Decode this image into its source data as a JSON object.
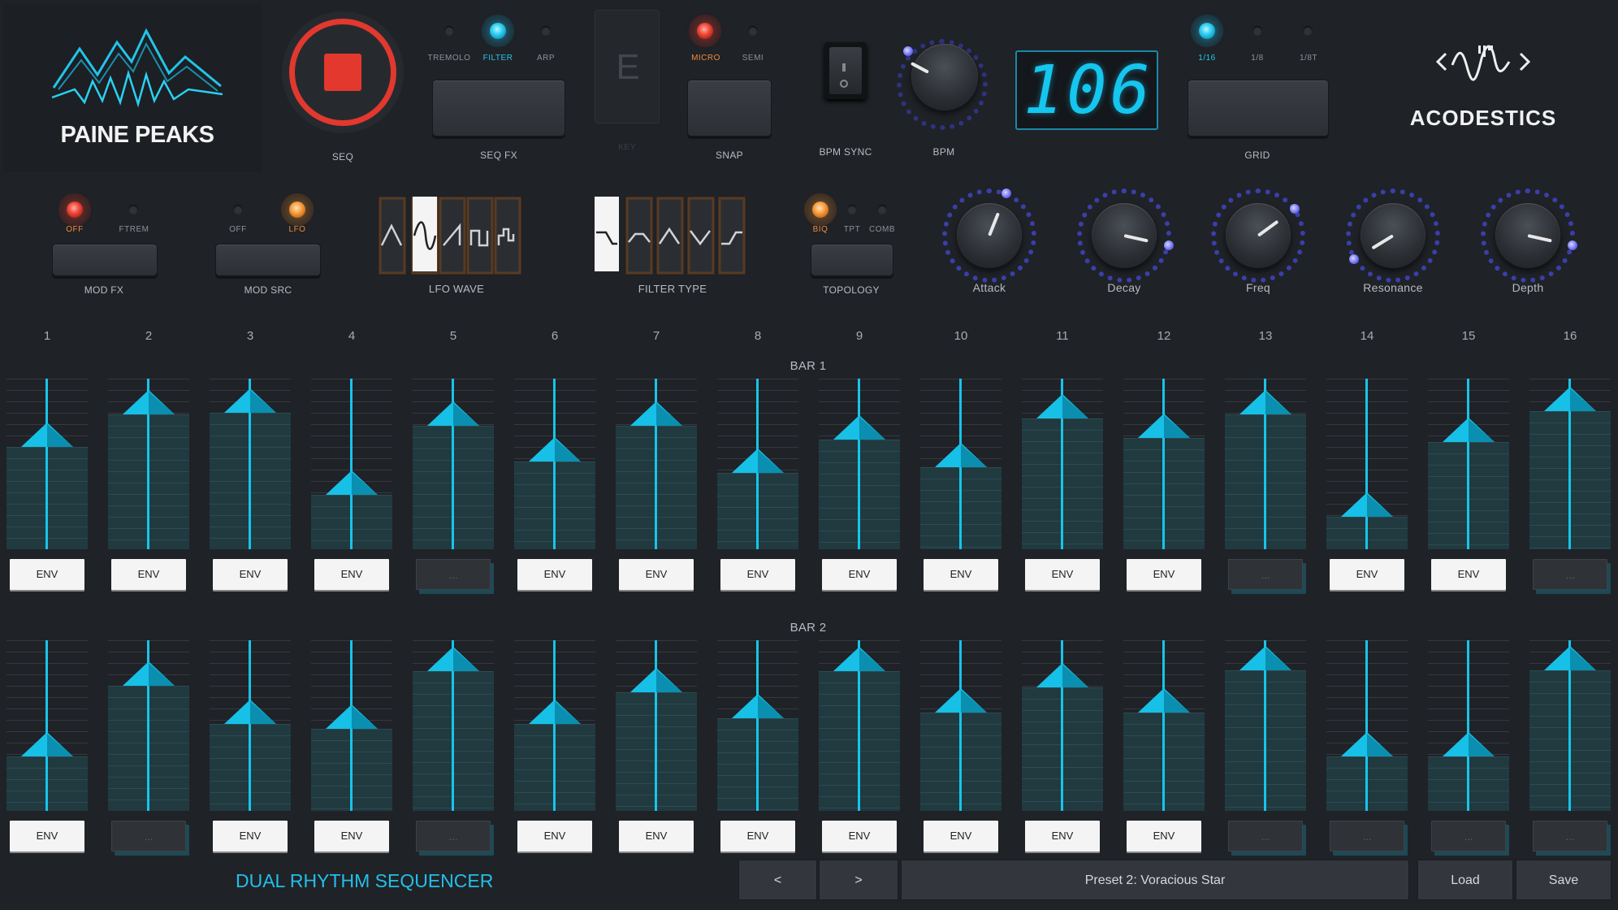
{
  "brand": {
    "name": "PAINE PEAKS",
    "company": "ACODESTICS"
  },
  "seq_label": "SEQ",
  "seq_fx": {
    "label": "SEQ FX",
    "options": [
      "TREMOLO",
      "FILTER",
      "ARP"
    ]
  },
  "key": {
    "value": "E",
    "label": "KEY"
  },
  "snap": {
    "label": "SNAP",
    "options": [
      "MICRO",
      "SEMI"
    ]
  },
  "bpm_sync_label": "BPM SYNC",
  "bpm": {
    "label": "BPM",
    "value": "106"
  },
  "grid": {
    "label": "GRID",
    "options": [
      "1/16",
      "1/8",
      "1/8T"
    ]
  },
  "mod_fx": {
    "label": "MOD FX",
    "options": [
      "OFF",
      "FTREM"
    ]
  },
  "mod_src": {
    "label": "MOD SRC",
    "options": [
      "OFF",
      "LFO"
    ]
  },
  "lfo_wave_label": "LFO WAVE",
  "filter_type_label": "FILTER TYPE",
  "topology": {
    "label": "TOPOLOGY",
    "options": [
      "BIQ",
      "TPT",
      "COMB"
    ]
  },
  "knobs": [
    {
      "label": "Attack",
      "level": 0.58
    },
    {
      "label": "Decay",
      "level": 0.88
    },
    {
      "label": "Freq",
      "level": 0.7
    },
    {
      "label": "Resonance",
      "level": 0.05
    },
    {
      "label": "Depth",
      "level": 0.88
    }
  ],
  "columns": [
    "1",
    "2",
    "3",
    "4",
    "5",
    "6",
    "7",
    "8",
    "9",
    "10",
    "11",
    "12",
    "13",
    "14",
    "15",
    "16"
  ],
  "bars": [
    {
      "label": "BAR 1",
      "levels": [
        0.7,
        0.92,
        0.93,
        0.37,
        0.84,
        0.6,
        0.84,
        0.52,
        0.75,
        0.56,
        0.89,
        0.76,
        0.92,
        0.22,
        0.73,
        0.94
      ],
      "env": [
        "ENV",
        "ENV",
        "ENV",
        "ENV",
        "...",
        "ENV",
        "ENV",
        "ENV",
        "ENV",
        "ENV",
        "ENV",
        "ENV",
        "...",
        "ENV",
        "ENV",
        "..."
      ]
    },
    {
      "label": "BAR 2",
      "levels": [
        0.37,
        0.85,
        0.59,
        0.56,
        0.95,
        0.59,
        0.81,
        0.63,
        0.95,
        0.67,
        0.84,
        0.67,
        0.96,
        0.37,
        0.37,
        0.96
      ],
      "env": [
        "ENV",
        "...",
        "ENV",
        "ENV",
        "...",
        "ENV",
        "ENV",
        "ENV",
        "ENV",
        "ENV",
        "ENV",
        "ENV",
        "...",
        "...",
        "...",
        "..."
      ]
    }
  ],
  "footer": {
    "title": "DUAL RHYTHM SEQUENCER",
    "prev": "<",
    "next": ">",
    "preset": "Preset 2: Voracious Star",
    "load": "Load",
    "save": "Save"
  },
  "colors": {
    "accent": "#18c4ea",
    "record": "#e2382e",
    "orange": "#f39a3f",
    "bg": "#1f2227"
  }
}
